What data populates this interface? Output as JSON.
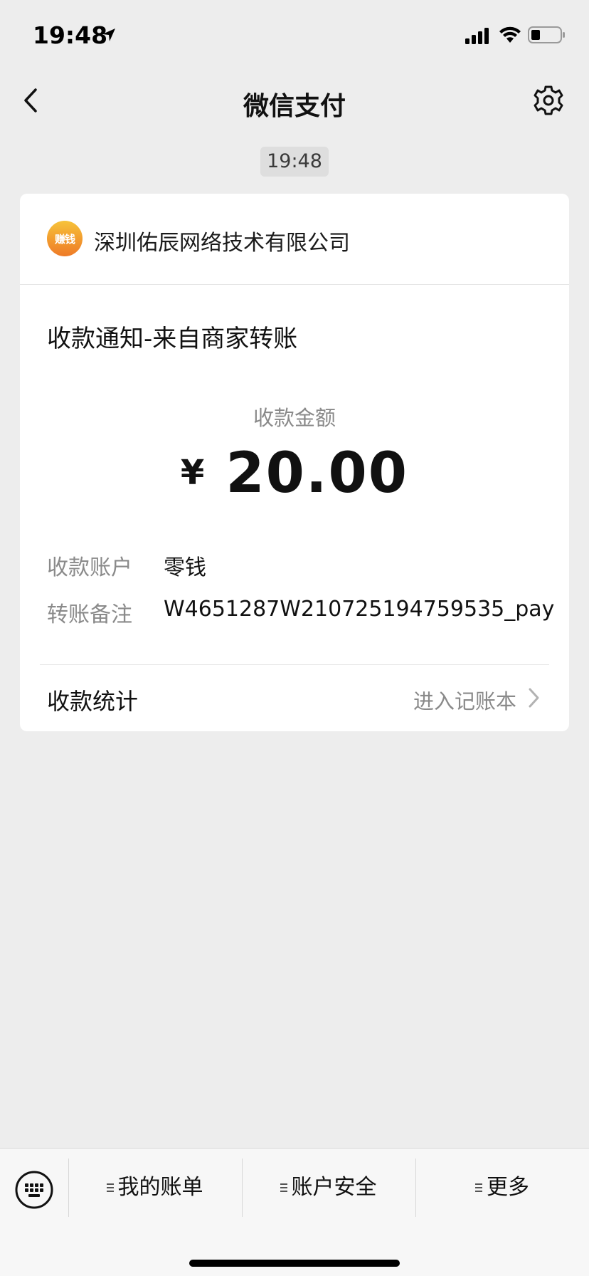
{
  "status_bar": {
    "time": "19:48"
  },
  "nav": {
    "title": "微信支付"
  },
  "message_time": "19:48",
  "card": {
    "merchant_name": "深圳佑辰网络技术有限公司",
    "merchant_logo_text": "赚钱",
    "notice_title": "收款通知-来自商家转账",
    "amount_label": "收款金额",
    "currency": "¥",
    "amount": "20.00",
    "details": [
      {
        "label": "收款账户",
        "value": "零钱"
      },
      {
        "label": "转账备注",
        "value": "W4651287W210725194759535_pay"
      }
    ],
    "stats_label": "收款统计",
    "stats_link": "进入记账本"
  },
  "bottom_menu": {
    "items": [
      {
        "label": "我的账单"
      },
      {
        "label": "账户安全"
      },
      {
        "label": "更多"
      }
    ]
  }
}
